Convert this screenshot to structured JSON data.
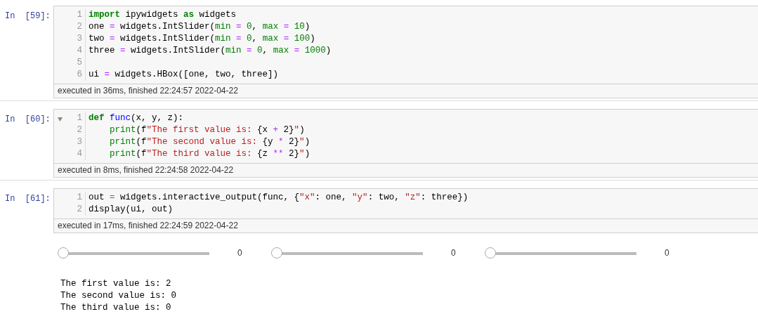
{
  "cells": [
    {
      "prompt": "In  [59]:",
      "collapsible": false,
      "lines": [
        {
          "number": "1",
          "tokens": [
            {
              "text": "import",
              "kind": "keyword"
            },
            {
              "text": " ipywidgets ",
              "kind": "plain"
            },
            {
              "text": "as",
              "kind": "keyword"
            },
            {
              "text": " widgets",
              "kind": "plain"
            }
          ]
        },
        {
          "number": "2",
          "tokens": [
            {
              "text": "one ",
              "kind": "plain"
            },
            {
              "text": "=",
              "kind": "operator"
            },
            {
              "text": " widgets.IntSlider(",
              "kind": "plain"
            },
            {
              "text": "min",
              "kind": "builtin"
            },
            {
              "text": " = ",
              "kind": "operator"
            },
            {
              "text": "0",
              "kind": "number"
            },
            {
              "text": ", ",
              "kind": "plain"
            },
            {
              "text": "max",
              "kind": "builtin"
            },
            {
              "text": " = ",
              "kind": "operator"
            },
            {
              "text": "10",
              "kind": "number"
            },
            {
              "text": ")",
              "kind": "plain"
            }
          ]
        },
        {
          "number": "3",
          "tokens": [
            {
              "text": "two ",
              "kind": "plain"
            },
            {
              "text": "=",
              "kind": "operator"
            },
            {
              "text": " widgets.IntSlider(",
              "kind": "plain"
            },
            {
              "text": "min",
              "kind": "builtin"
            },
            {
              "text": " = ",
              "kind": "operator"
            },
            {
              "text": "0",
              "kind": "number"
            },
            {
              "text": ", ",
              "kind": "plain"
            },
            {
              "text": "max",
              "kind": "builtin"
            },
            {
              "text": " = ",
              "kind": "operator"
            },
            {
              "text": "100",
              "kind": "number"
            },
            {
              "text": ")",
              "kind": "plain"
            }
          ]
        },
        {
          "number": "4",
          "tokens": [
            {
              "text": "three ",
              "kind": "plain"
            },
            {
              "text": "=",
              "kind": "operator"
            },
            {
              "text": " widgets.IntSlider(",
              "kind": "plain"
            },
            {
              "text": "min",
              "kind": "builtin"
            },
            {
              "text": " = ",
              "kind": "operator"
            },
            {
              "text": "0",
              "kind": "number"
            },
            {
              "text": ", ",
              "kind": "plain"
            },
            {
              "text": "max",
              "kind": "builtin"
            },
            {
              "text": " = ",
              "kind": "operator"
            },
            {
              "text": "1000",
              "kind": "number"
            },
            {
              "text": ")",
              "kind": "plain"
            }
          ]
        },
        {
          "number": "5"
        },
        {
          "number": "6",
          "tokens": [
            {
              "text": "ui ",
              "kind": "plain"
            },
            {
              "text": "=",
              "kind": "operator"
            },
            {
              "text": " widgets.HBox([one, two, three])",
              "kind": "plain"
            }
          ]
        }
      ],
      "footer": "executed in 36ms, finished 22:24:57 2022-04-22"
    },
    {
      "prompt": "In  [60]:",
      "collapsible": true,
      "lines": [
        {
          "number": "1",
          "tokens": [
            {
              "text": "def ",
              "kind": "keyword"
            },
            {
              "text": "func",
              "kind": "def"
            },
            {
              "text": "(x, y, z):",
              "kind": "plain"
            }
          ]
        },
        {
          "number": "2",
          "tokens": [
            {
              "text": "    print",
              "kind": "builtin"
            },
            {
              "text": "(f",
              "kind": "plain"
            },
            {
              "text": "\"The first value is: ",
              "kind": "string"
            },
            {
              "text": "{x ",
              "kind": "plain"
            },
            {
              "text": "+",
              "kind": "operator"
            },
            {
              "text": " 2}",
              "kind": "plain"
            },
            {
              "text": "\"",
              "kind": "string"
            },
            {
              "text": ")",
              "kind": "plain"
            }
          ]
        },
        {
          "number": "3",
          "tokens": [
            {
              "text": "    print",
              "kind": "builtin"
            },
            {
              "text": "(f",
              "kind": "plain"
            },
            {
              "text": "\"The second value is: ",
              "kind": "string"
            },
            {
              "text": "{y ",
              "kind": "plain"
            },
            {
              "text": "*",
              "kind": "operator"
            },
            {
              "text": " 2}",
              "kind": "plain"
            },
            {
              "text": "\"",
              "kind": "string"
            },
            {
              "text": ")",
              "kind": "plain"
            }
          ]
        },
        {
          "number": "4",
          "tokens": [
            {
              "text": "    print",
              "kind": "builtin"
            },
            {
              "text": "(f",
              "kind": "plain"
            },
            {
              "text": "\"The third value is: ",
              "kind": "string"
            },
            {
              "text": "{z ",
              "kind": "plain"
            },
            {
              "text": "**",
              "kind": "operator"
            },
            {
              "text": " 2}",
              "kind": "plain"
            },
            {
              "text": "\"",
              "kind": "string"
            },
            {
              "text": ")",
              "kind": "plain"
            }
          ]
        }
      ],
      "footer": "executed in 8ms, finished 22:24:58 2022-04-22"
    },
    {
      "prompt": "In  [61]:",
      "collapsible": false,
      "lines": [
        {
          "number": "1",
          "tokens": [
            {
              "text": "out ",
              "kind": "plain"
            },
            {
              "text": "=",
              "kind": "operator"
            },
            {
              "text": " widgets.interactive_output(func, {",
              "kind": "plain"
            },
            {
              "text": "\"x\"",
              "kind": "string"
            },
            {
              "text": ": one, ",
              "kind": "plain"
            },
            {
              "text": "\"y\"",
              "kind": "string"
            },
            {
              "text": ": two, ",
              "kind": "plain"
            },
            {
              "text": "\"z\"",
              "kind": "string"
            },
            {
              "text": ": three})",
              "kind": "plain"
            }
          ]
        },
        {
          "number": "2",
          "tokens": [
            {
              "text": "display(ui, out)",
              "kind": "plain"
            }
          ]
        }
      ],
      "footer": "executed in 17ms, finished 22:24:59 2022-04-22",
      "sliders": [
        {
          "level": 0,
          "reading": "0"
        },
        {
          "level": 0,
          "reading": "0"
        },
        {
          "level": 0,
          "reading": "0"
        }
      ],
      "output": [
        "The first value is: 2",
        "The second value is: 0",
        "The third value is: 0"
      ]
    }
  ]
}
